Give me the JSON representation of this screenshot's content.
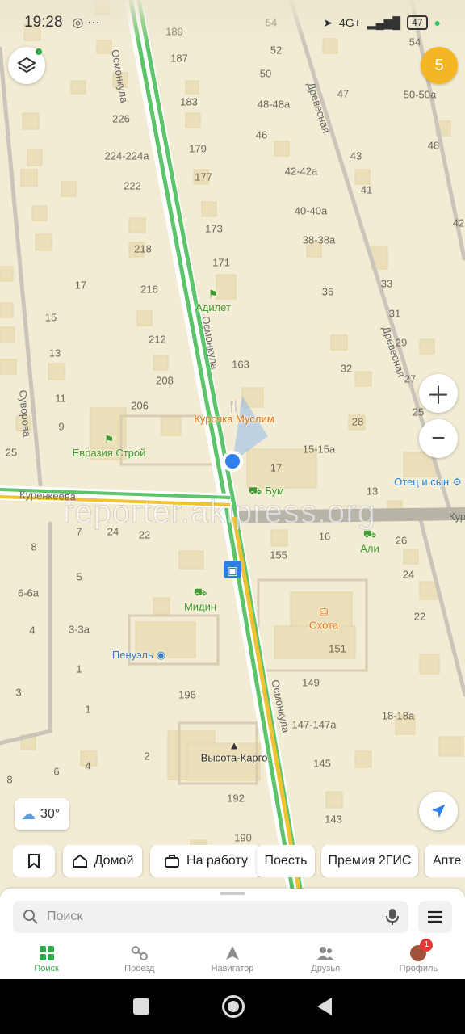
{
  "status_bar": {
    "time": "19:28",
    "network": "4G+",
    "battery": "47"
  },
  "map": {
    "house_numbers": [
      "189",
      "54",
      "52",
      "187",
      "50",
      "54",
      "47",
      "48-48а",
      "50-50а",
      "183",
      "226",
      "179",
      "46",
      "48",
      "43",
      "224-224а",
      "42-42а",
      "177",
      "41",
      "222",
      "40-40а",
      "173",
      "42",
      "38-38а",
      "218",
      "171",
      "33",
      "17",
      "216",
      "36",
      "15",
      "31",
      "212",
      "29",
      "13",
      "163",
      "32",
      "208",
      "27",
      "11",
      "206",
      "25",
      "28",
      "9",
      "15-15а",
      "17",
      "25",
      "13",
      "7",
      "24",
      "22",
      "16",
      "26",
      "8",
      "155",
      "5",
      "24",
      "6-6а",
      "22",
      "4",
      "3-3а",
      "151",
      "1",
      "3",
      "196",
      "149",
      "1",
      "147-147а",
      "18-18а",
      "2",
      "145",
      "4",
      "6",
      "8",
      "192",
      "143",
      "190"
    ],
    "streets": [
      "Осмонкула",
      "Осмонкула",
      "Осмонкула",
      "Древесная",
      "Древесная",
      "Суворова",
      "Куренкеева",
      "Кур"
    ],
    "pois": [
      {
        "name": "Адилет",
        "color": "green"
      },
      {
        "name": "Курочка Муслим",
        "color": "orange"
      },
      {
        "name": "Евразия Строй",
        "color": "green"
      },
      {
        "name": "Бум",
        "color": "green"
      },
      {
        "name": "Отец и сын",
        "color": "blue"
      },
      {
        "name": "Али",
        "color": "green"
      },
      {
        "name": "Мидин",
        "color": "green"
      },
      {
        "name": "Охота",
        "color": "orange"
      },
      {
        "name": "Пенуэль",
        "color": "blue"
      },
      {
        "name": "Высота-Карго",
        "color": "dark"
      }
    ],
    "watermark": "reporter.akipress.org"
  },
  "notification_badge": "5",
  "weather": {
    "temp": "30°",
    "icon": "cloud-sun-icon"
  },
  "chips": [
    {
      "label": "",
      "icon": "bookmark-icon"
    },
    {
      "label": "Домой",
      "icon": "home-icon"
    },
    {
      "label": "На работу",
      "icon": "briefcase-icon"
    },
    {
      "label": "Поесть",
      "icon": ""
    },
    {
      "label": "Премия 2ГИС",
      "icon": ""
    },
    {
      "label": "Апте",
      "icon": ""
    }
  ],
  "search": {
    "placeholder": "Поиск"
  },
  "tabs": [
    {
      "label": "Поиск",
      "icon": "search-grid-icon",
      "active": true
    },
    {
      "label": "Проезд",
      "icon": "route-icon",
      "active": false
    },
    {
      "label": "Навигатор",
      "icon": "navigator-icon",
      "active": false
    },
    {
      "label": "Друзья",
      "icon": "friends-icon",
      "active": false
    },
    {
      "label": "Профиль",
      "icon": "profile-icon",
      "active": false,
      "badge": "1"
    }
  ],
  "colors": {
    "accent": "#2ea84a",
    "badge": "#f5b623",
    "location": "#2f80ed",
    "traffic_green": "#5cc46b",
    "traffic_yellow": "#f1c232"
  }
}
